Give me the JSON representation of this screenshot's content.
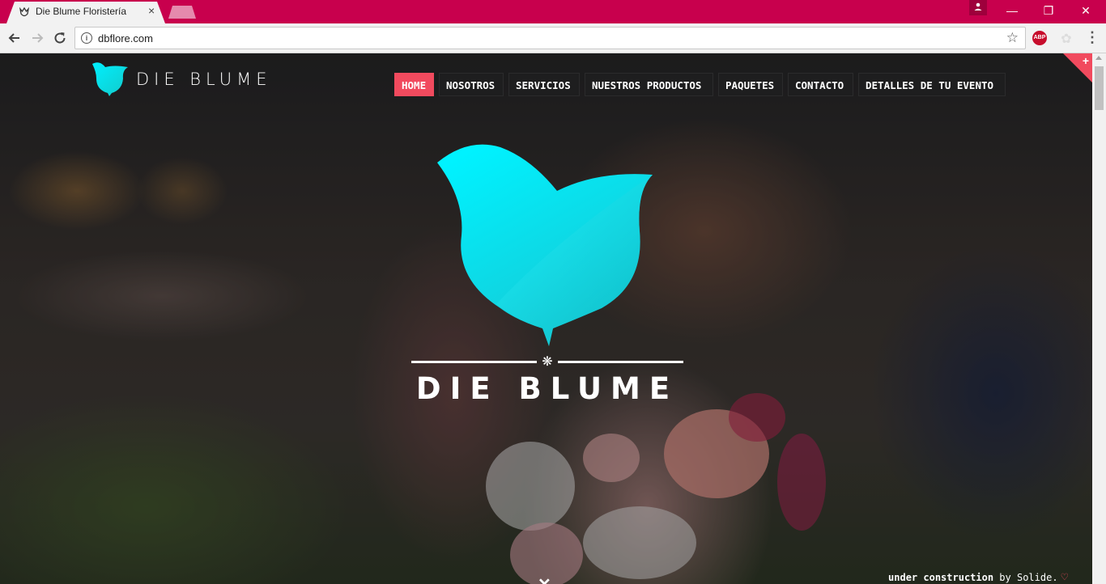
{
  "browser": {
    "tab_title": "Die Blume Floristería",
    "tab_close": "×",
    "url": "dbflore.com",
    "info_icon": "i",
    "star_icon": "☆",
    "abp_label": "ABP",
    "menu_icon": "⋮",
    "window_buttons": {
      "minimize": "—",
      "restore": "❐",
      "close": "✕"
    }
  },
  "site": {
    "logo_text": "DIE BLUME",
    "nav": [
      {
        "label": "HOME",
        "active": true
      },
      {
        "label": "NOSOTROS",
        "active": false
      },
      {
        "label": "SERVICIOS",
        "active": false
      },
      {
        "label": "NUESTROS PRODUCTOS",
        "active": false
      },
      {
        "label": "PAQUETES",
        "active": false
      },
      {
        "label": "CONTACTO",
        "active": false
      },
      {
        "label": "DETALLES DE TU EVENTO",
        "active": false
      }
    ],
    "corner_plus": "+",
    "hero_title": "DIE BLUME",
    "hero_ornament": "❋",
    "scroll_down": "✕",
    "credit": {
      "part1": "under construction",
      "part2": " by Solide.",
      "heart": "♡"
    }
  },
  "colors": {
    "chrome_accent": "#c8004d",
    "active_nav": "#f14a5e",
    "logo_cyan": "#00e5f5"
  }
}
